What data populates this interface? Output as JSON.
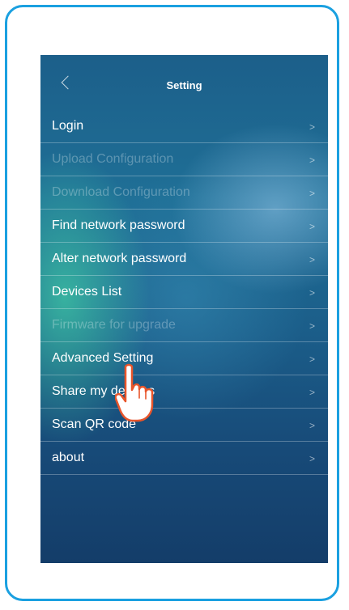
{
  "header": {
    "title": "Setting",
    "back_icon": "chevron-left-icon"
  },
  "menu": [
    {
      "label": "Login",
      "enabled": true
    },
    {
      "label": "Upload Configuration",
      "enabled": false
    },
    {
      "label": "Download Configuration",
      "enabled": false
    },
    {
      "label": "Find network password",
      "enabled": true
    },
    {
      "label": "Alter network password",
      "enabled": true
    },
    {
      "label": "Devices List",
      "enabled": true
    },
    {
      "label": "Firmware for upgrade",
      "enabled": false
    },
    {
      "label": "Advanced Setting",
      "enabled": true
    },
    {
      "label": "Share my devices",
      "enabled": true
    },
    {
      "label": "Scan QR code",
      "enabled": true
    },
    {
      "label": "about",
      "enabled": true
    }
  ],
  "chevron": ">",
  "colors": {
    "frame": "#1aa0e0",
    "background": "#1b5d89"
  }
}
